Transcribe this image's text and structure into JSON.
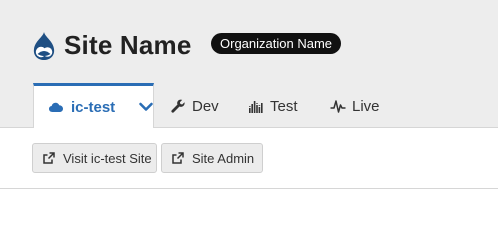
{
  "header": {
    "site_name": "Site Name",
    "organization": "Organization Name",
    "logo_icon": "drupal-drop-icon"
  },
  "tabs": [
    {
      "label": "ic-test",
      "icon": "cloud-icon",
      "active": true,
      "has_dropdown": true
    },
    {
      "label": "Dev",
      "icon": "wrench-icon",
      "active": false
    },
    {
      "label": "Test",
      "icon": "equalizer-icon",
      "active": false
    },
    {
      "label": "Live",
      "icon": "heartbeat-icon",
      "active": false
    }
  ],
  "actions": {
    "visit_site_label": "Visit ic-test Site",
    "site_admin_label": "Site Admin",
    "icon": "external-link-icon"
  },
  "colors": {
    "accent": "#2a6db5",
    "header_bg": "#ededed",
    "badge_bg": "#111111"
  }
}
